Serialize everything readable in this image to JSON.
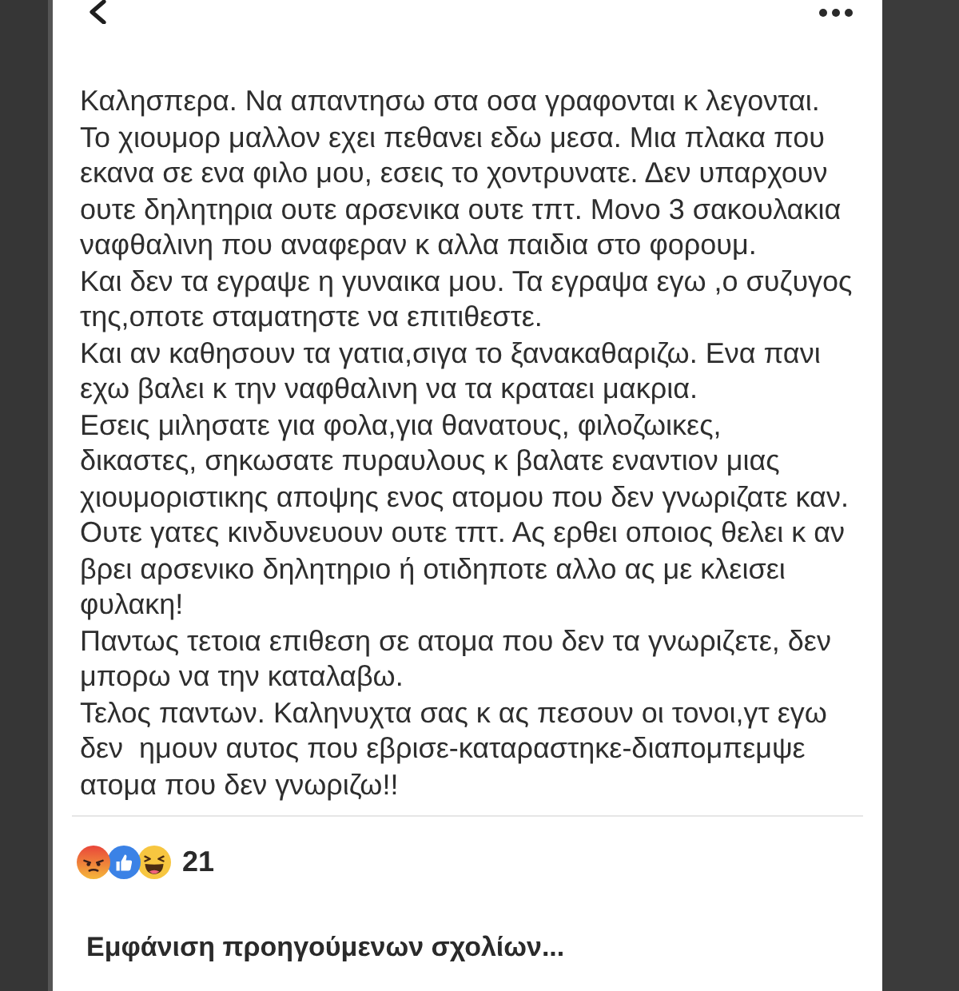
{
  "post": {
    "lines": [
      "Καλησπερα. Να απαντησω στα οσα γραφονται κ λεγονται.",
      "Το χιουμορ μαλλον εχει πεθανει εδω μεσα. Μια πλακα που",
      "εκανα σε ενα φιλο μου, εσεις το χοντρυνατε. Δεν υπαρχουν",
      "ουτε δηλητηρια ουτε αρσενικα ουτε τπτ. Μονο 3 σακουλακια",
      "ναφθαλινη που αναφεραν κ αλλα παιδια στο φορουμ.",
      "Και δεν τα εγραψε η γυναικα μου. Τα εγραψα εγω ,ο συζυγος",
      "της,οποτε σταματηστε να επιτιθεστε.",
      "Και αν καθησουν τα γατια,σιγα το ξανακαθαριζω. Ενα πανι",
      "εχω βαλει κ την ναφθαλινη να τα κραταει μακρια.",
      "Εσεις μιλησατε για φολα,για θανατους, φιλοζωικες,",
      "δικαστες, σηκωσατε πυραυλους κ βαλατε εναντιον μιας",
      "χιουμοριστικης αποψης ενος ατομου που δεν γνωριζατε καν.",
      "Ουτε γατες κινδυνευουν ουτε τπτ. Ας ερθει οποιος θελει κ αν",
      "βρει αρσενικο δηλητηριο ή οτιδηποτε αλλο ας με κλεισει",
      "φυλακη!",
      "Παντως τετοια επιθεση σε ατομα που δεν τα γνωριζετε, δεν",
      "μπορω να την καταλαβω.",
      "Τελος παντων. Καληνυχτα σας κ ας πεσουν οι τονοι,γτ εγω",
      "δεν  ημουν αυτος που εβρισε-καταραστηκε-διαπομπεμψε",
      "ατομα που δεν γνωριζω!!"
    ]
  },
  "reactions": {
    "count": "21"
  },
  "comments": {
    "show_previous": "Εμφάνιση προηγούμενων σχολίων..."
  }
}
